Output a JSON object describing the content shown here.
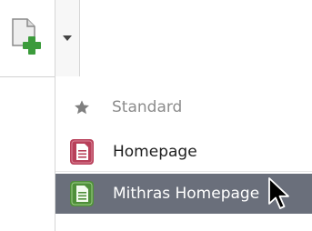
{
  "toolbar": {
    "new_button_icon": "new-document-plus-icon",
    "dropdown_icon": "chevron-down-icon"
  },
  "menu": {
    "items": [
      {
        "label": "Standard",
        "icon": "star-icon",
        "state": "disabled"
      },
      {
        "label": "Homepage",
        "icon": "page-doc-icon",
        "icon_color": "#b8405a"
      },
      {
        "label": "Mithras Homepage",
        "icon": "page-doc-icon",
        "icon_color": "#4f8f3a",
        "state": "highlighted"
      }
    ]
  },
  "colors": {
    "highlight_bg": "#6a6f7b",
    "accent_green": "#3b9b3b"
  }
}
